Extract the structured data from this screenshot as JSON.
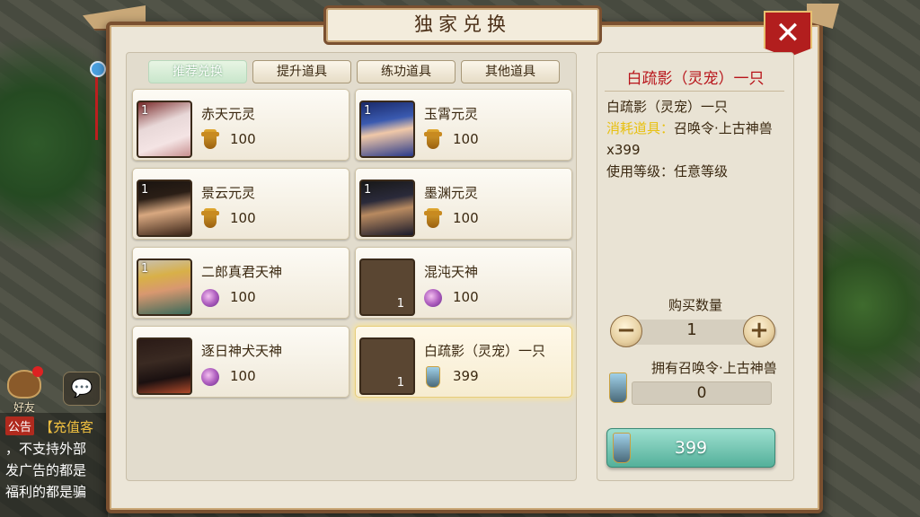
{
  "title": "独家兑换",
  "close_symbol": "✕",
  "tabs": [
    {
      "label": "推荐兑换",
      "active": true
    },
    {
      "label": "提升道具",
      "active": false
    },
    {
      "label": "练功道具",
      "active": false
    },
    {
      "label": "其他道具",
      "active": false
    }
  ],
  "items": [
    {
      "name": "赤天元灵",
      "count": "1",
      "cost": "100",
      "cost_icon": "scroll-icon"
    },
    {
      "name": "玉霄元灵",
      "count": "1",
      "cost": "100",
      "cost_icon": "scroll-icon"
    },
    {
      "name": "景云元灵",
      "count": "1",
      "cost": "100",
      "cost_icon": "scroll-icon"
    },
    {
      "name": "墨渊元灵",
      "count": "1",
      "cost": "100",
      "cost_icon": "scroll-icon"
    },
    {
      "name": "二郎真君天神",
      "count": "1",
      "cost": "100",
      "cost_icon": "orb-icon"
    },
    {
      "name": "混沌天神",
      "count": "1",
      "cost": "100",
      "cost_icon": "orb-icon"
    },
    {
      "name": "逐日神犬天神",
      "count": "",
      "cost": "100",
      "cost_icon": "orb-icon"
    },
    {
      "name": "白疏影（灵宠）一只",
      "count": "1",
      "cost": "399",
      "cost_icon": "summon-token-icon",
      "selected": true
    }
  ],
  "detail": {
    "title": "白疏影（灵宠）一只",
    "line1": "白疏影（灵宠）一只",
    "consume_label": "消耗道具：",
    "consume_value": "召唤令·上古神兽 x399",
    "level_line": "使用等级：任意等级",
    "qty_label": "购买数量",
    "qty_value": "1",
    "minus": "−",
    "plus": "+",
    "own_label": "拥有召唤令·上古神兽",
    "own_value": "0",
    "buy_price": "399"
  },
  "hud": {
    "friend_label": "好友",
    "chat_icon": "💬",
    "notice_label": "公告",
    "notice_text_1": "【充值客",
    "notice_text_2": "，不支持外部",
    "notice_text_3": "发广告的都是",
    "notice_text_4": "福利的都是骗"
  },
  "colors": {
    "accent_red": "#b8141a",
    "highlight_yellow": "#e8c010",
    "buy_green": "#54b09a"
  }
}
